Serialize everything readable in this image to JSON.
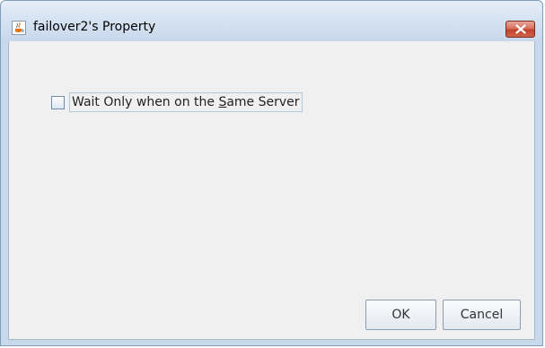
{
  "window": {
    "title": "failover2's Property"
  },
  "options": {
    "wait_same_server": {
      "label_prefix": "Wait Only when on the ",
      "label_mnemonic": "S",
      "label_suffix": "ame Server",
      "checked": false
    }
  },
  "buttons": {
    "ok_label": "OK",
    "cancel_label": "Cancel"
  },
  "icons": {
    "title": "java-cup-icon",
    "close": "close-icon"
  },
  "colors": {
    "close_button": "#c1412a",
    "dialog_background": "#f0f0f0",
    "frame": "#c9d9ec"
  }
}
